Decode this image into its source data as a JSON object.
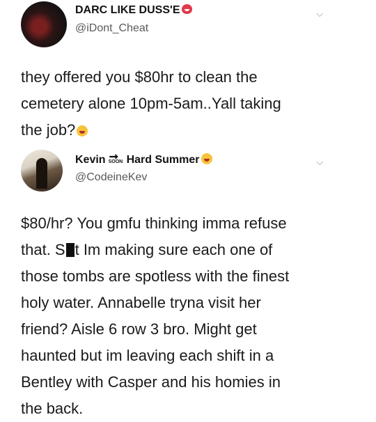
{
  "tweets": [
    {
      "display_name": "DARC LIKE DUSS'E",
      "handle": "@iDont_Cheat",
      "avatar_icon": "profile-avatar",
      "name_emoji": "smiling-devil-emoji",
      "text_lines": [
        "they offered you $80hr to clean the",
        "cemetery alone 10pm-5am..Yall taking",
        "the job?"
      ],
      "text_emoji": "laughing-emoji"
    },
    {
      "display_name_part1": "Kevin",
      "soon_label": "SOON",
      "display_name_part2": "Hard Summer",
      "handle": "@CodeineKev",
      "avatar_icon": "profile-avatar",
      "name_emoji": "grinning-sweat-emoji",
      "text_lines": [
        "$80/hr? You gmfu thinking imma refuse",
        "that. S",
        "t Im making sure each one of",
        "those tombs are spotless with the finest",
        "holy water. Annabelle tryna visit her",
        "friend? Aisle 6 row 3 bro. Might get",
        "haunted but im leaving each shift in a",
        "Bentley with Casper and his homies in",
        "the back."
      ]
    }
  ],
  "chevron_glyph": "⌵",
  "colors": {
    "text": "#1a1a1a",
    "handle": "#5a5a5a",
    "chevron": "#8a8a8a"
  }
}
